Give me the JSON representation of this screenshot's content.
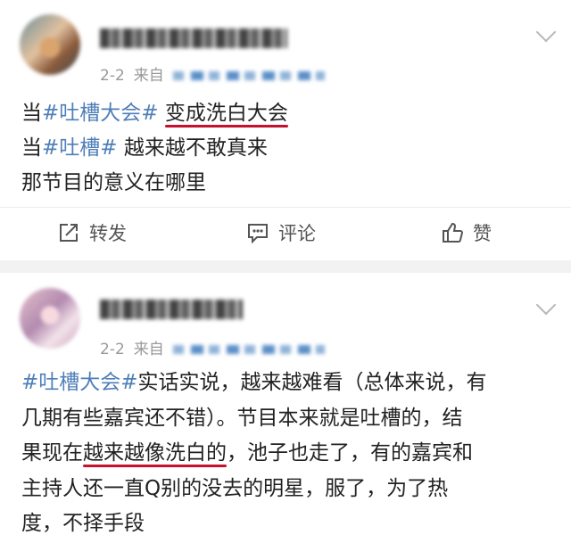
{
  "posts": [
    {
      "time": "2-2",
      "source_prefix": "来自",
      "text_lines": [
        {
          "parts": [
            {
              "t": "当",
              "style": "normal"
            },
            {
              "t": "#吐槽大会#",
              "style": "tag"
            },
            {
              "t": " ",
              "style": "normal"
            },
            {
              "t": "变成洗白大会",
              "style": "underline"
            }
          ]
        },
        {
          "parts": [
            {
              "t": "当",
              "style": "normal"
            },
            {
              "t": "#吐槽#",
              "style": "tag"
            },
            {
              "t": " 越来越不敢真来",
              "style": "normal"
            }
          ]
        },
        {
          "parts": [
            {
              "t": "那节目的意义在哪里",
              "style": "normal"
            }
          ]
        }
      ],
      "actions": {
        "repost": "转发",
        "comment": "评论",
        "like": "赞"
      }
    },
    {
      "time": "2-2",
      "source_prefix": "来自",
      "text_lines": [
        {
          "parts": [
            {
              "t": "#吐槽大会#",
              "style": "tag"
            },
            {
              "t": "实话实说，越来越难看（总体来说，有",
              "style": "normal"
            }
          ]
        },
        {
          "parts": [
            {
              "t": "几期有些嘉宾还不错）。节目本来就是吐槽的，结",
              "style": "normal"
            }
          ]
        },
        {
          "parts": [
            {
              "t": "果现在",
              "style": "normal"
            },
            {
              "t": "越来越像洗白的",
              "style": "underline"
            },
            {
              "t": "，池子也走了，有的嘉宾和",
              "style": "normal"
            }
          ]
        },
        {
          "parts": [
            {
              "t": "主持人还一直Q别的没去的明星，服了，为了热",
              "style": "normal"
            }
          ]
        },
        {
          "parts": [
            {
              "t": "度，不择手段",
              "style": "normal"
            }
          ]
        }
      ]
    }
  ],
  "colors": {
    "tag": "#4f7fb8",
    "underline": "#c8102e",
    "meta": "#999999",
    "separator": "#f2f2f2"
  },
  "icons": {
    "repost": "repost-icon",
    "comment": "comment-icon",
    "like": "thumbs-up-icon",
    "more": "chevron-down-icon"
  }
}
